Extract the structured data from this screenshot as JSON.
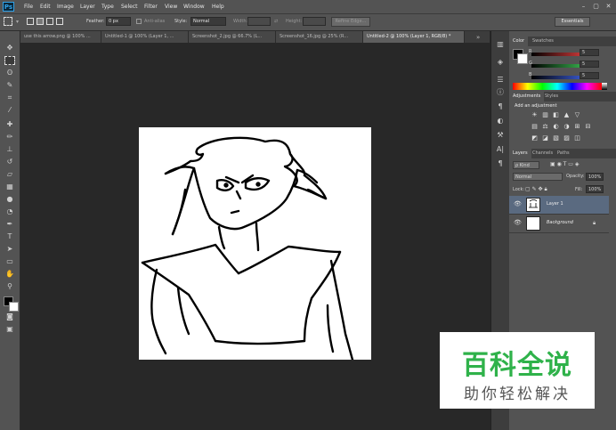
{
  "app": {
    "logo": "Ps"
  },
  "menu": [
    "File",
    "Edit",
    "Image",
    "Layer",
    "Type",
    "Select",
    "Filter",
    "View",
    "Window",
    "Help"
  ],
  "window_controls": [
    "–",
    "▢",
    "✕"
  ],
  "options": {
    "feather_label": "Feather:",
    "feather_value": "0 px",
    "antialias_label": "Anti-alias",
    "style_label": "Style:",
    "style_value": "Normal",
    "width_label": "Width:",
    "height_label": "Height:",
    "refine_edge": "Refine Edge...",
    "workspace": "Essentials"
  },
  "tabs": [
    {
      "label": "use this arrow.png @ 100% ...",
      "active": false
    },
    {
      "label": "Untitled-1 @ 100% (Layer 1, ...",
      "active": false
    },
    {
      "label": "Screenshot_2.jpg @ 66.7% (L...",
      "active": false
    },
    {
      "label": "Screenshot_16.jpg @ 25% (R...",
      "active": false
    },
    {
      "label": "Untitled-2 @ 100% (Layer 1, RGB/8) *",
      "active": true
    }
  ],
  "color_panel": {
    "tabs": [
      "Color",
      "Swatches"
    ],
    "rows": [
      {
        "label": "R",
        "value": "5"
      },
      {
        "label": "G",
        "value": "5"
      },
      {
        "label": "B",
        "value": "5"
      }
    ],
    "colors": {
      "red": "#d23a3a",
      "green": "#37b24d",
      "blue": "#3a5ad2"
    }
  },
  "adjustments_panel": {
    "tabs": [
      "Adjustments",
      "Styles"
    ],
    "title": "Add an adjustment",
    "icons_row1": [
      "☀",
      "▥",
      "◧",
      "▲",
      "▽"
    ],
    "icons_row2": [
      "▤",
      "⚖",
      "◐",
      "◑",
      "⊞",
      "⊟"
    ],
    "icons_row3": [
      "◩",
      "◪",
      "▧",
      "▨",
      "◫"
    ]
  },
  "layers_panel": {
    "tabs": [
      "Layers",
      "Channels",
      "Paths"
    ],
    "kind": "ρ Kind",
    "blend_mode": "Normal",
    "opacity_label": "Opacity:",
    "opacity_value": "100%",
    "lock_label": "Lock:",
    "fill_label": "Fill:",
    "fill_value": "100%",
    "layers": [
      {
        "name": "Layer 1",
        "selected": true
      },
      {
        "name": "Background",
        "selected": false
      }
    ]
  },
  "watermark": {
    "main": "百科全说",
    "sub": "助你轻松解决"
  }
}
